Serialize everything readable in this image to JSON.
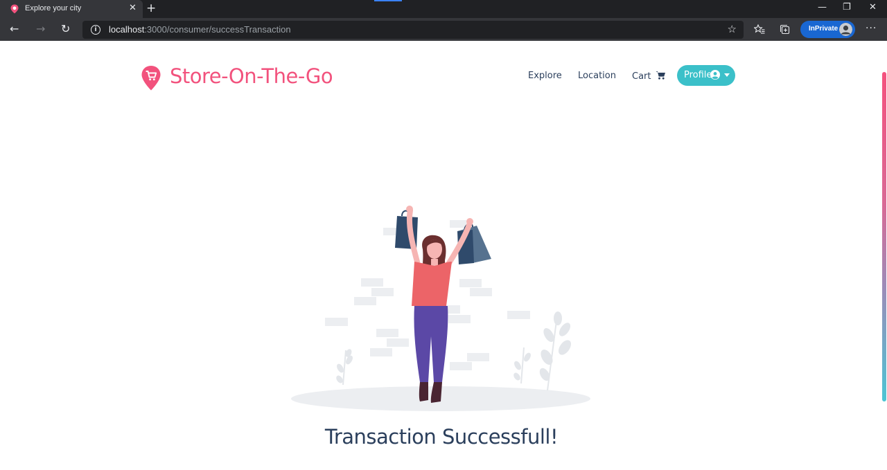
{
  "browser": {
    "tab_title": "Explore your city",
    "tab_close": "✕",
    "new_tab": "+",
    "url_host": "localhost",
    "url_rest": ":3000/consumer/successTransaction",
    "inprivate_label": "InPrivate",
    "window_controls": {
      "minimize": "—",
      "restore": "❐",
      "close": "✕"
    },
    "nav": {
      "back": "←",
      "forward": "→",
      "refresh": "↻"
    },
    "icons": [
      "info-icon",
      "star-icon",
      "favorites-icon",
      "collections-icon",
      "more-icon"
    ]
  },
  "site": {
    "brand_name": "Store-On-The-Go",
    "brand_color": "#f2527d",
    "nav": {
      "explore": "Explore",
      "location": "Location",
      "cart": "Cart",
      "profile": "Profile"
    },
    "accent_color": "#3bc0c9"
  },
  "main": {
    "message": "Transaction Successfull!"
  }
}
